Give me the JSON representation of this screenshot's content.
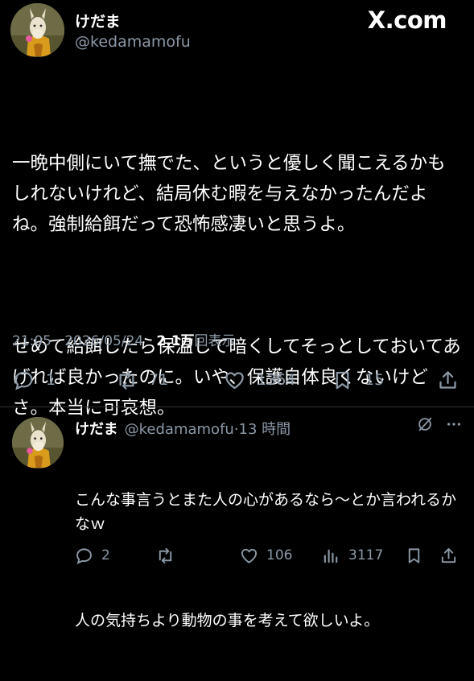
{
  "header": {
    "author_name": "けだま",
    "author_handle": "@kedamamofu",
    "watermark": "X.com"
  },
  "tweet": {
    "paragraphs": [
      "一晩中側にいて撫でた、というと優しく聞こえるかもしれないけれど、結局休む暇を与えなかったんだよね。強制給餌だって恐怖感凄いと思うよ。",
      "せめて給餌したら保温して暗くしてそっとしておいてあげれば良かったのに。いや、保護自体良くないけどさ。本当に可哀想。"
    ],
    "time": "21:05",
    "date": "2026/05/24",
    "views_count": "2.1万",
    "views_label": "回表示",
    "stats": {
      "replies": "1",
      "reposts": "71",
      "likes": "1364",
      "bookmarks": "15"
    }
  },
  "reply": {
    "author_name": "けだま",
    "author_handle": "@kedamamofu",
    "time_ago": "13 時間",
    "paragraphs": [
      "こんな事言うとまた人の心があるなら〜とか言われるかなｗ",
      "人の気持ちより動物の事を考えて欲しいよ。"
    ],
    "stats": {
      "replies": "2",
      "likes": "106",
      "views": "3117"
    }
  },
  "icons": {
    "reply": "reply-icon",
    "repost": "repost-icon",
    "like": "heart-icon",
    "bookmark": "bookmark-icon",
    "share": "share-icon",
    "views": "views-icon",
    "grok": "grok-icon",
    "more": "more-icon"
  }
}
